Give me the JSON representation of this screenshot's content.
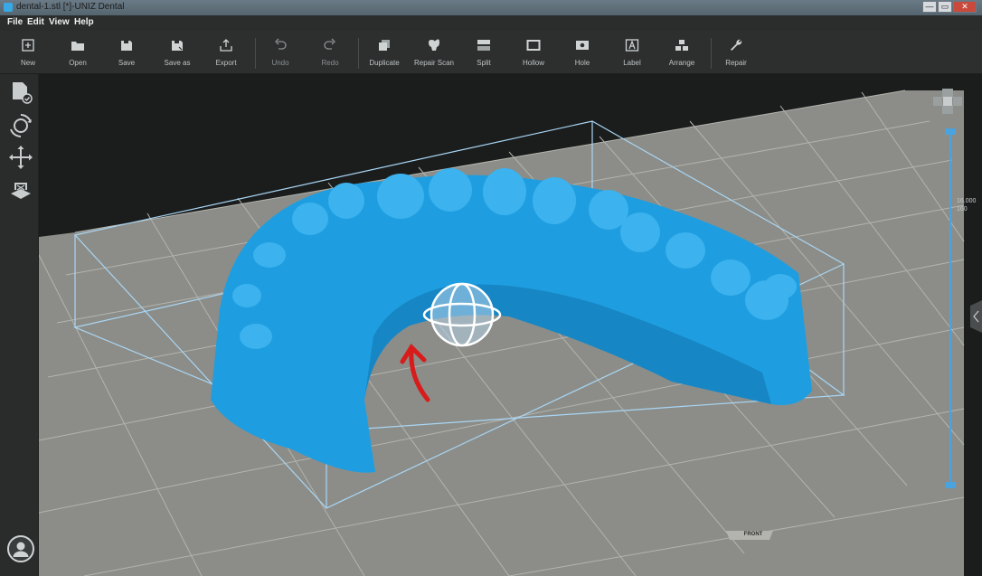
{
  "window": {
    "title": "dental-1.stl [*]-UNIZ Dental",
    "minimize": "—",
    "maximize": "▭",
    "close": "✕"
  },
  "menu": [
    "File",
    "Edit",
    "View",
    "Help"
  ],
  "toolbar": [
    {
      "label": "New",
      "icon": "new-icon"
    },
    {
      "label": "Open",
      "icon": "folder-open-icon"
    },
    {
      "label": "Save",
      "icon": "save-icon"
    },
    {
      "label": "Save as",
      "icon": "save-as-icon"
    },
    {
      "label": "Export",
      "icon": "export-icon"
    },
    {
      "label": "Undo",
      "icon": "undo-icon"
    },
    {
      "label": "Redo",
      "icon": "redo-icon"
    },
    {
      "label": "Duplicate",
      "icon": "duplicate-icon"
    },
    {
      "label": "Repair Scan",
      "icon": "tooth-icon"
    },
    {
      "label": "Split",
      "icon": "split-icon"
    },
    {
      "label": "Hollow",
      "icon": "hollow-icon"
    },
    {
      "label": "Hole",
      "icon": "hole-icon"
    },
    {
      "label": "Label",
      "icon": "label-icon"
    },
    {
      "label": "Arrange",
      "icon": "arrange-icon"
    },
    {
      "label": "Repair",
      "icon": "wrench-icon"
    }
  ],
  "left_tools": [
    "import-model-icon",
    "rotate-icon",
    "move-icon",
    "build-plate-icon"
  ],
  "z_slider": {
    "top_value": "16.000",
    "second_value": "160"
  },
  "front_label": "FRONT",
  "colors": {
    "model": "#1e9ee0",
    "platform": "#8c8d88",
    "grid": "#b3b4ad",
    "bounding_box": "#a9d6f5",
    "annotation_arrow": "#d81b1b",
    "slider": "#4aa3df"
  }
}
